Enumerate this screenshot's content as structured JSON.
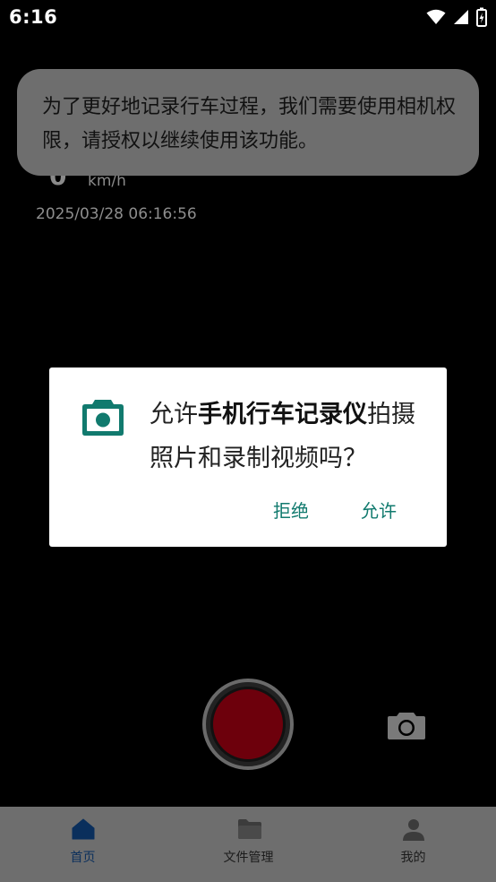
{
  "status_bar": {
    "time": "6:16"
  },
  "dashboard": {
    "speed_value": "0",
    "speed_unit": "km/h",
    "timestamp": "2025/03/28 06:16:56"
  },
  "toast": {
    "message": "为了更好地记录行车过程，我们需要使用相机权限，请授权以继续使用该功能。"
  },
  "permission_dialog": {
    "prefix": "允许",
    "app_name": "手机行车记录仪",
    "suffix": "拍摄照片和录制视频吗？",
    "deny_label": "拒绝",
    "allow_label": "允许",
    "accent_color": "#117a6e"
  },
  "bottom_nav": {
    "items": [
      {
        "label": "首页",
        "icon": "home-icon",
        "active": true
      },
      {
        "label": "文件管理",
        "icon": "folder-icon",
        "active": false
      },
      {
        "label": "我的",
        "icon": "person-icon",
        "active": false
      }
    ]
  }
}
